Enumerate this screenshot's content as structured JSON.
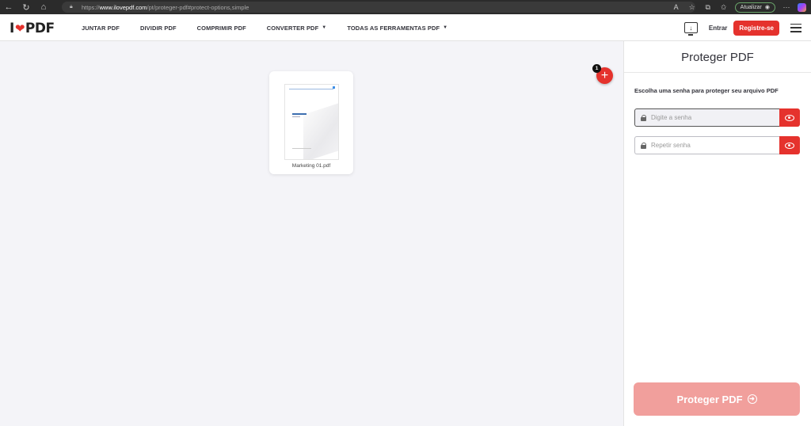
{
  "browser": {
    "url_prefix": "https://",
    "url_host": "www.ilovepdf.com",
    "url_path": "/pt/proteger-pdf#protect-options,simple",
    "update_label": "Atualizar"
  },
  "header": {
    "logo_left": "I",
    "logo_right": "PDF",
    "nav": [
      {
        "label": "JUNTAR PDF",
        "has_caret": false
      },
      {
        "label": "DIVIDIR PDF",
        "has_caret": false
      },
      {
        "label": "COMPRIMIR PDF",
        "has_caret": false
      },
      {
        "label": "CONVERTER PDF",
        "has_caret": true
      },
      {
        "label": "TODAS AS FERRAMENTAS PDF",
        "has_caret": true
      }
    ],
    "login_label": "Entrar",
    "register_label": "Registre-se"
  },
  "workspace": {
    "file_name": "Marketing 01.pdf",
    "file_count": "1",
    "add_symbol": "+"
  },
  "sidebar": {
    "title": "Proteger PDF",
    "hint": "Escolha uma senha para proteger seu arquivo PDF",
    "password_placeholder": "Digite a senha",
    "repeat_placeholder": "Repetir senha",
    "submit_label": "Proteger PDF"
  },
  "colors": {
    "brand_red": "#e5322d",
    "submit_disabled": "#f19f9c"
  }
}
